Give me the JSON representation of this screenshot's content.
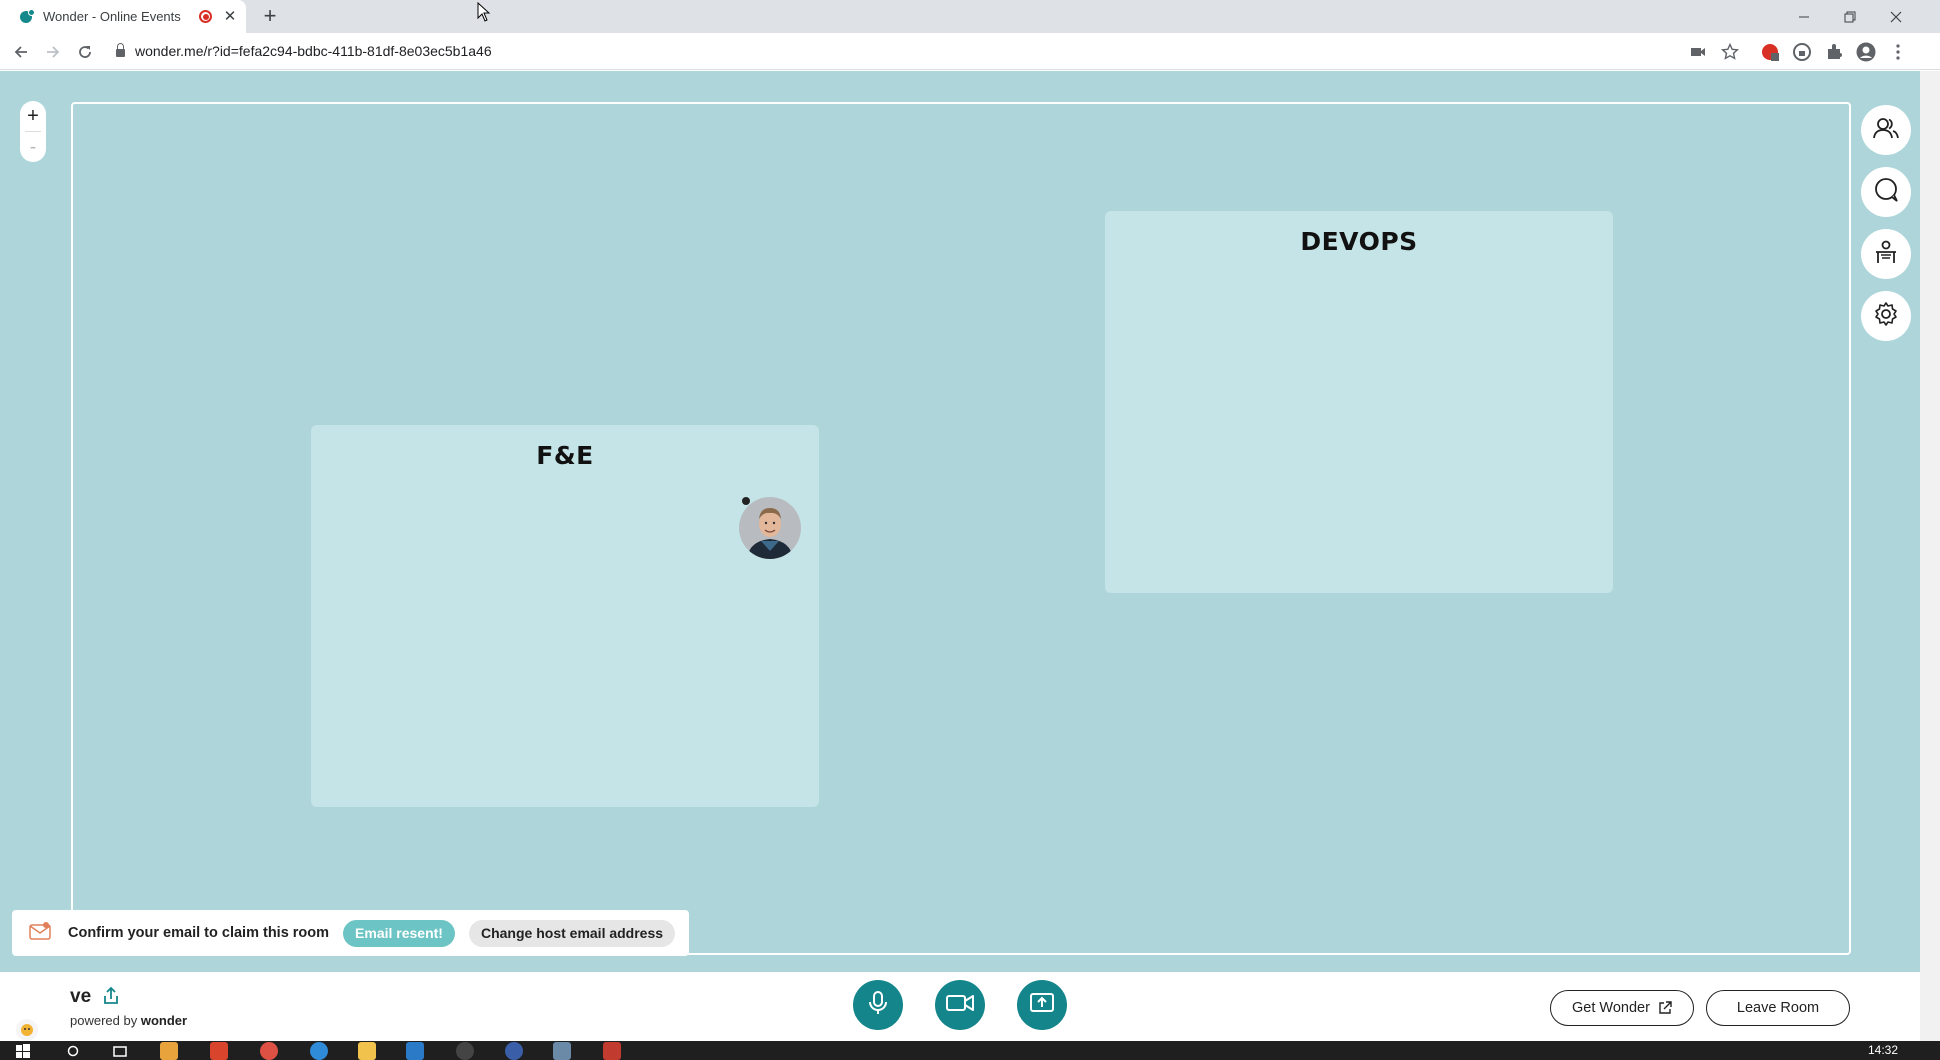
{
  "browser": {
    "tab_title": "Wonder - Online Events",
    "new_tab": "+",
    "url": "wonder.me/r?id=fefa2c94-bdbc-411b-81df-8e03ec5b1a46"
  },
  "canvas": {
    "zoom_in": "+",
    "zoom_out": "-",
    "areas": [
      {
        "title": "F&E",
        "participants": 1
      },
      {
        "title": "DEVOPS",
        "participants": 0
      }
    ]
  },
  "side_toolbar": [
    "people-icon",
    "chat-icon",
    "broadcast-icon",
    "settings-icon"
  ],
  "email_banner": {
    "message": "Confirm your email to claim this room",
    "resent_label": "Email resent!",
    "change_label": "Change host email address"
  },
  "bottom_bar": {
    "room_name": "ve",
    "powered_prefix": "powered by",
    "powered_brand": "wonder",
    "get_wonder_label": "Get Wonder",
    "leave_label": "Leave Room"
  },
  "taskbar": {
    "clock": "14:32"
  },
  "colors": {
    "canvas_bg": "#aed6da",
    "area_bg": "#c5e4e7",
    "accent": "#14868b",
    "resent_pill": "#6cc4c4"
  }
}
